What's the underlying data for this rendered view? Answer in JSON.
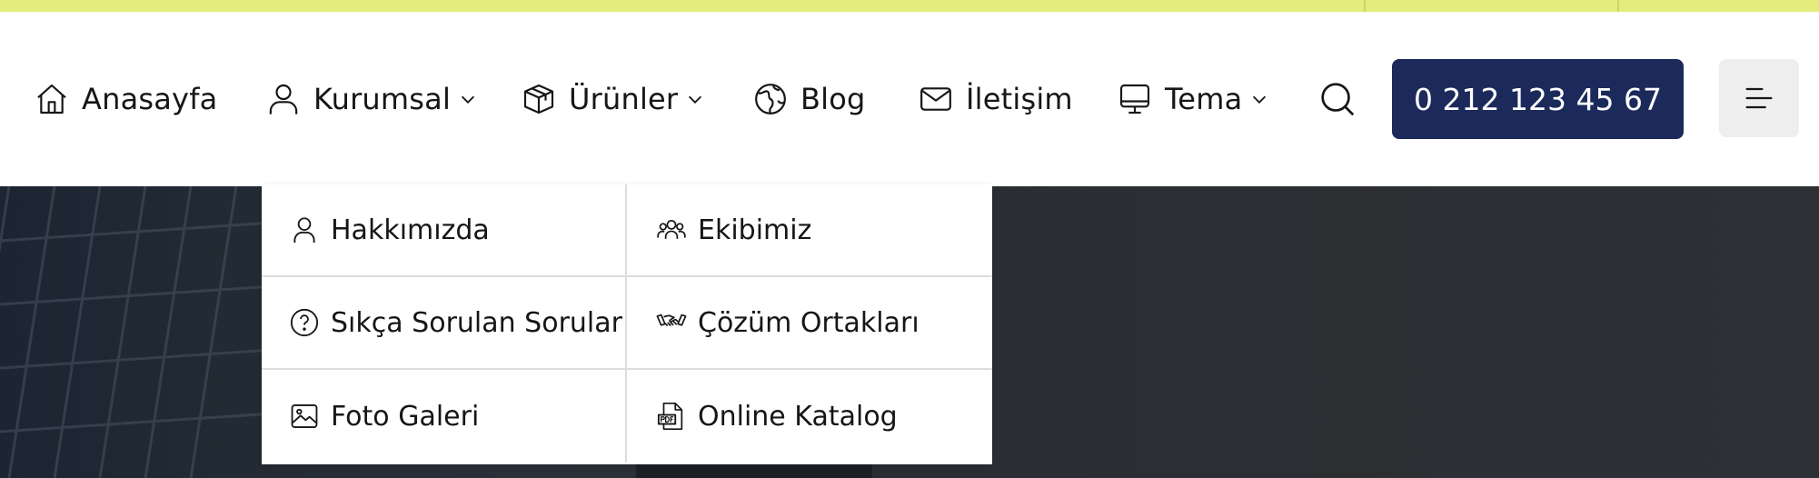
{
  "nav": {
    "items": [
      {
        "label": "Anasayfa",
        "icon": "home-icon",
        "has_dropdown": false
      },
      {
        "label": "Kurumsal",
        "icon": "user-icon",
        "has_dropdown": true
      },
      {
        "label": "Ürünler",
        "icon": "box-icon",
        "has_dropdown": true
      },
      {
        "label": "Blog",
        "icon": "globe-icon",
        "has_dropdown": false
      },
      {
        "label": "İletişim",
        "icon": "mail-icon",
        "has_dropdown": false
      },
      {
        "label": "Tema",
        "icon": "monitor-icon",
        "has_dropdown": true
      }
    ],
    "search_icon": "search-icon",
    "phone_label": "0 212 123 45 67",
    "menu_icon": "hamburger-icon"
  },
  "dropdown": {
    "items": [
      {
        "label": "Hakkımızda",
        "icon": "user-icon"
      },
      {
        "label": "Ekibimiz",
        "icon": "team-icon"
      },
      {
        "label": "Sıkça Sorulan Sorular",
        "icon": "question-circle-icon"
      },
      {
        "label": "Çözüm Ortakları",
        "icon": "handshake-icon"
      },
      {
        "label": "Foto Galeri",
        "icon": "image-icon"
      },
      {
        "label": "Online Katalog",
        "icon": "pdf-file-icon"
      }
    ]
  },
  "colors": {
    "top_bar": "#e4ec7e",
    "phone_button": "#1b2a5b",
    "menu_button": "#eeeeee",
    "hero_background": "#2b2e32"
  }
}
